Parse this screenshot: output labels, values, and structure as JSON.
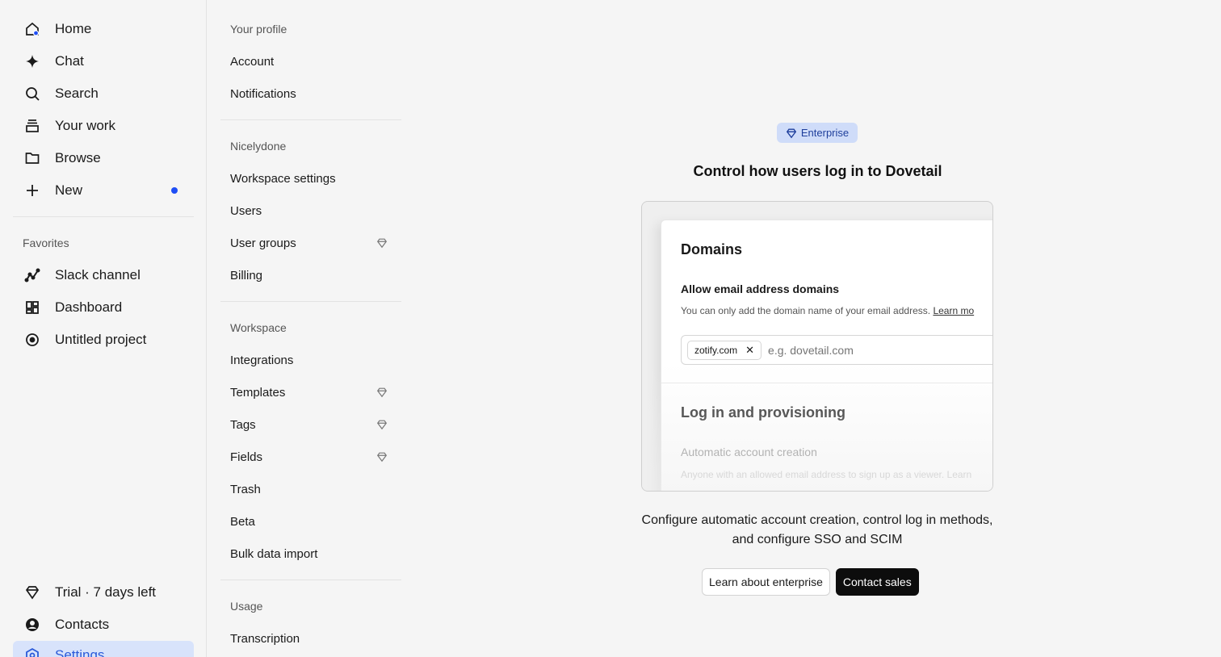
{
  "sidebar": {
    "items": [
      {
        "label": "Home",
        "icon": "home-icon"
      },
      {
        "label": "Chat",
        "icon": "sparkle-icon"
      },
      {
        "label": "Search",
        "icon": "search-icon"
      },
      {
        "label": "Your work",
        "icon": "stack-icon"
      },
      {
        "label": "Browse",
        "icon": "folder-icon"
      },
      {
        "label": "New",
        "icon": "plus-icon"
      }
    ],
    "favorites_heading": "Favorites",
    "favorites": [
      {
        "label": "Slack channel",
        "icon": "chart-line-icon"
      },
      {
        "label": "Dashboard",
        "icon": "dashboard-icon"
      },
      {
        "label": "Untitled project",
        "icon": "target-icon"
      }
    ],
    "bottom": [
      {
        "label": "Trial · 7 days left",
        "icon": "diamond-icon"
      },
      {
        "label": "Contacts",
        "icon": "user-circle-icon"
      },
      {
        "label": "Settings",
        "icon": "settings-icon"
      }
    ]
  },
  "settings_menu": {
    "profile_heading": "Your profile",
    "profile_items": [
      "Account",
      "Notifications"
    ],
    "org_heading": "Nicelydone",
    "org_items": [
      "Workspace settings",
      "Users",
      "User groups",
      "Billing"
    ],
    "workspace_heading": "Workspace",
    "workspace_items": [
      "Integrations",
      "Templates",
      "Tags",
      "Fields",
      "Trash",
      "Beta",
      "Bulk data import"
    ],
    "usage_heading": "Usage",
    "usage_items": [
      "Transcription"
    ]
  },
  "main": {
    "badge": "Enterprise",
    "title": "Control how users log in to Dovetail",
    "preview": {
      "domains_title": "Domains",
      "allow_label": "Allow email address domains",
      "help_text": "You can only add the domain name of your email address.",
      "help_link": "Learn mo",
      "chip": "zotify.com",
      "input_placeholder": "e.g. dovetail.com",
      "login_title": "Log in and provisioning",
      "auto_label": "Automatic account creation",
      "auto_help": "Anyone with an allowed email address to sign up as a viewer. Learn"
    },
    "description": "Configure automatic account creation, control log in methods, and configure SSO and SCIM",
    "learn_button": "Learn about enterprise",
    "contact_button": "Contact sales"
  },
  "colors": {
    "accent": "#1f4ef5",
    "active_bg": "#d8e3fb",
    "badge_bg": "#cfdcf9"
  }
}
